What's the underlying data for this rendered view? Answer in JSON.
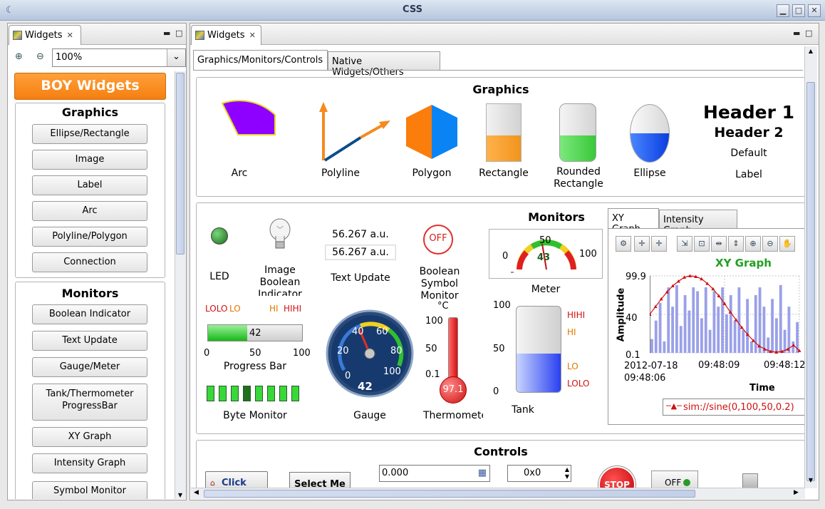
{
  "window": {
    "title": "CSS"
  },
  "palette": {
    "tab_label": "Widgets",
    "zoom": "100%",
    "banner": "BOY Widgets",
    "graphics_title": "Graphics",
    "graphics_items": [
      "Ellipse/Rectangle",
      "Image",
      "Label",
      "Arc",
      "Polyline/Polygon",
      "Connection"
    ],
    "monitors_title": "Monitors",
    "monitor_items": [
      "Boolean Indicator",
      "Text Update",
      "Gauge/Meter",
      "Tank/Thermometer\nProgressBar",
      "XY Graph",
      "Intensity Graph",
      "Symbol Monitor"
    ]
  },
  "editor": {
    "tab_label": "Widgets",
    "tabs": [
      "Graphics/Monitors/Controls",
      "Native Widgets/Others"
    ],
    "graphics": {
      "title": "Graphics",
      "captions": {
        "arc": "Arc",
        "polyline": "Polyline",
        "polygon": "Polygon",
        "rectangle": "Rectangle",
        "rounded_1": "Rounded",
        "rounded_2": "Rectangle",
        "ellipse": "Ellipse",
        "label": "Label"
      },
      "header1": "Header 1",
      "header2": "Header 2",
      "default_text": "Default",
      "rectangle_fill": 0.45,
      "rounded_fill": 0.45,
      "ellipse_fill": 0.5
    },
    "monitors": {
      "title": "Monitors",
      "led_label": "LED",
      "image_bool_label_1": "Image",
      "image_bool_label_2": "Boolean",
      "image_bool_label_3": "Indicator",
      "text_update_value_1": "56.267 a.u.",
      "text_update_value_2": "56.267 a.u.",
      "text_update_label": "Text Update",
      "bool_symbol_state": "OFF",
      "bool_symbol_label_1": "Boolean Symbol",
      "bool_symbol_label_2": "Monitor",
      "meter": {
        "label": "Meter",
        "min": "0",
        "mid": "50",
        "max": "100",
        "value": "43"
      },
      "progress": {
        "label": "Progress Bar",
        "value": 42,
        "value_text": "42",
        "lolo": "LOLO",
        "lo": "LO",
        "hi": "HI",
        "hihi": "HIHI",
        "ticks": [
          "0",
          "50",
          "100"
        ]
      },
      "gauge": {
        "label": "Gauge",
        "value_text": "42",
        "ticks": [
          "0",
          "20",
          "40",
          "60",
          "80",
          "100"
        ]
      },
      "thermometer": {
        "label": "Thermometer",
        "unit": "°C",
        "value_text": "97.1",
        "ticks": [
          "100",
          "50",
          "0.1"
        ]
      },
      "tank": {
        "label": "Tank",
        "value": 0.45,
        "ticks": [
          "100",
          "50",
          "0"
        ],
        "hihi": "HIHI",
        "hi": "HI",
        "lo": "LO",
        "lolo": "LOLO"
      },
      "byte_monitor_label": "Byte Monitor",
      "graph_tabs": [
        "XY Graph",
        "Intensity Graph"
      ],
      "xy": {
        "title": "XY Graph",
        "ylabel": "Amplitude",
        "xlabel": "Time",
        "yticks": [
          "99.9",
          "40",
          "0.1"
        ],
        "xticks": [
          "2012-07-18\n09:48:06",
          "09:48:09",
          "09:48:12"
        ],
        "legend": "sim://sine(0,100,50,0.2)"
      }
    },
    "controls": {
      "title": "Controls",
      "button_click": "Click",
      "select": "Select Me",
      "spinner_value": "0.000",
      "hex_value": "0x0",
      "stop_label": "STOP",
      "toggle_label": "OFF"
    }
  },
  "colors": {
    "orange": "#fb8c1e",
    "led_green": "#2f8f2f",
    "graph_red": "#d01010",
    "graph_bars": "#9aa0e8"
  },
  "chart_data": {
    "type": "bar",
    "title": "XY Graph",
    "ylabel": "Amplitude",
    "xlabel": "Time",
    "ylim": [
      0.1,
      99.9
    ],
    "x_tick_labels": [
      "2012-07-18 09:48:06",
      "09:48:09",
      "09:48:12"
    ],
    "series": [
      {
        "name": "sim://sine(0,100,50,0.2)",
        "type": "bar",
        "values": [
          18,
          42,
          65,
          15,
          85,
          60,
          88,
          35,
          75,
          55,
          85,
          80,
          45,
          85,
          30,
          80,
          60,
          85,
          50,
          75,
          42,
          85,
          30,
          70,
          15,
          75,
          85,
          60,
          20,
          70,
          45,
          88,
          30,
          60,
          15,
          40
        ]
      },
      {
        "name": "sim://sine(0,100,50,0.2)",
        "type": "line",
        "values": [
          50,
          60,
          70,
          79,
          87,
          93,
          98,
          100,
          99,
          96,
          90,
          83,
          74,
          64,
          53,
          43,
          33,
          24,
          16,
          9,
          5,
          2,
          1,
          2,
          5,
          10,
          3
        ]
      }
    ]
  }
}
